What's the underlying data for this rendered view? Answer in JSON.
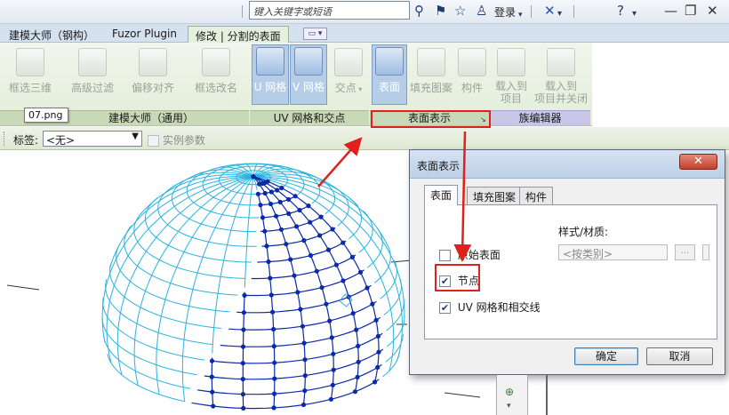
{
  "title_bar": {
    "search_placeholder": "键入关键字或短语",
    "login_label": "登录",
    "icons": [
      "binoculars-icon",
      "comm-center-icon",
      "favorites-star-icon",
      "user-icon",
      "exchange-x-icon",
      "help-icon"
    ]
  },
  "tabs": [
    {
      "label": "建模大师（钢构）"
    },
    {
      "label": "Fuzor Plugin"
    },
    {
      "label": "修改 | 分割的表面"
    }
  ],
  "ribbon": {
    "buttons": [
      {
        "label": "框选三维"
      },
      {
        "label": "高级过滤"
      },
      {
        "label": "偏移对齐"
      },
      {
        "label": "框选改名"
      },
      {
        "label": "U 网格"
      },
      {
        "label": "V 网格"
      },
      {
        "label": "交点"
      },
      {
        "label": "表面"
      },
      {
        "label": "填充图案"
      },
      {
        "label": "构件"
      },
      {
        "label": "载入到",
        "label2": "项目"
      },
      {
        "label": "载入到",
        "label2": "项目并关闭"
      }
    ],
    "panels": [
      {
        "label": "建模大师（通用）"
      },
      {
        "label": "UV 网格和交点"
      },
      {
        "label": "表面表示"
      },
      {
        "label": "族编辑器"
      }
    ],
    "tooltip": "07.png"
  },
  "options_bar": {
    "label": "标签:",
    "select_value": "<无>",
    "instance_param_label": "实例参数"
  },
  "dialog": {
    "title": "表面表示",
    "tabs": [
      {
        "label": "表面"
      },
      {
        "label": "填充图案"
      },
      {
        "label": "构件"
      }
    ],
    "original_surface_label": "原始表面",
    "nodes_label": "节点",
    "uv_grid_label": "UV 网格和相交线",
    "style_material_label": "样式/材质:",
    "style_value": "<按类别>",
    "browse_label": "...",
    "ok_label": "确定",
    "cancel_label": "取消",
    "nodes_checked": true,
    "uv_grid_checked": true,
    "original_surface_checked": false
  },
  "colors": {
    "highlight_red": "#e0201b",
    "mesh_light": "#2bb3df",
    "mesh_dark": "#0a2aa8"
  }
}
